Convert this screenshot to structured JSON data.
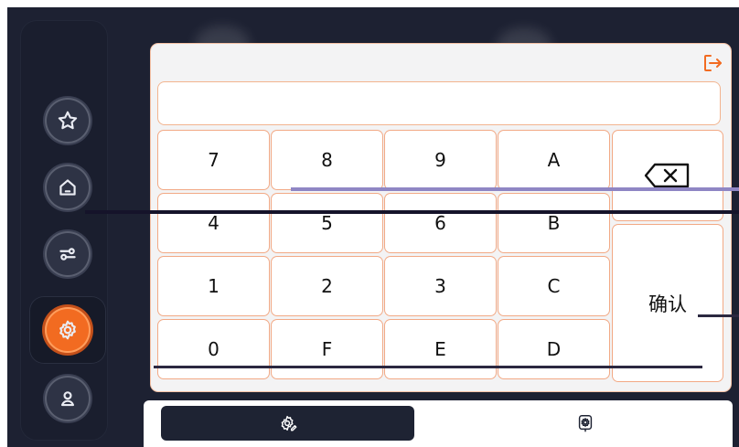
{
  "nav": {
    "items": [
      {
        "name": "favorites",
        "icon": "star-icon"
      },
      {
        "name": "home",
        "icon": "home-icon"
      },
      {
        "name": "controls",
        "icon": "sliders-icon"
      },
      {
        "name": "settings",
        "icon": "gear-icon",
        "active": true
      },
      {
        "name": "user",
        "icon": "user-icon"
      }
    ]
  },
  "keypad": {
    "display_value": "",
    "keys": [
      "7",
      "8",
      "9",
      "A",
      "4",
      "5",
      "6",
      "B",
      "1",
      "2",
      "3",
      "C",
      "0",
      "F",
      "E",
      "D"
    ],
    "backspace_icon": "backspace-icon",
    "confirm_label": "确认",
    "exit_icon": "exit-icon"
  },
  "tabs": [
    {
      "icon": "settings-pen-icon",
      "active": true
    },
    {
      "icon": "settings-badge-icon",
      "active": false
    }
  ],
  "colors": {
    "background": "#1d2132",
    "accent": "#f26b21",
    "panel": "#f3f3f4",
    "key_border": "#f2a985"
  }
}
